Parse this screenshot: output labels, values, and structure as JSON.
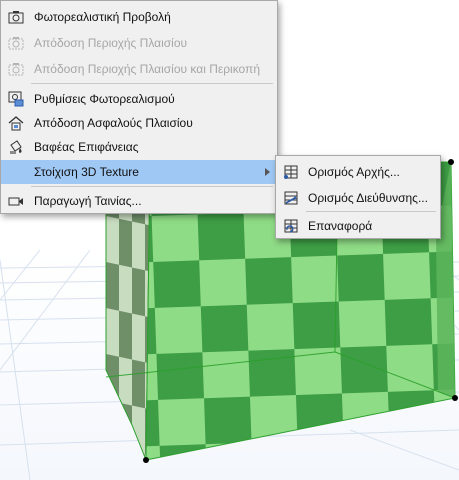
{
  "menu": {
    "items": [
      {
        "label": "Φωτορεαλιστική Προβολή",
        "icon": "camera-icon",
        "enabled": true
      },
      {
        "label": "Απόδοση Περιοχής Πλαισίου",
        "icon": "camera-marquee-icon",
        "enabled": false
      },
      {
        "label": "Απόδοση Περιοχής Πλαισίου και Περικοπή",
        "icon": "camera-crop-icon",
        "enabled": false
      },
      {
        "label": "Ρυθμίσεις Φωτορεαλισμού",
        "icon": "render-settings-icon",
        "enabled": true
      },
      {
        "label": "Απόδοση Ασφαλούς Πλαισίου",
        "icon": "safe-frame-icon",
        "enabled": true
      },
      {
        "label": "Βαφέας Επιφάνειας",
        "icon": "paint-bucket-icon",
        "enabled": true
      },
      {
        "label": "Στοίχιση 3D Texture",
        "icon": "",
        "enabled": true,
        "highlighted": true
      },
      {
        "label": "Παραγωγή Ταινίας...",
        "icon": "movie-camera-icon",
        "enabled": true
      }
    ]
  },
  "submenu": {
    "items": [
      {
        "label": "Ορισμός Αρχής...",
        "icon": "set-origin-icon"
      },
      {
        "label": "Ορισμός Διεύθυνσης...",
        "icon": "set-direction-icon"
      },
      {
        "label": "Επαναφορά",
        "icon": "reset-icon"
      }
    ]
  },
  "colors": {
    "menu_highlight": "#9fc8f4",
    "texture_light": "#8fdc86",
    "texture_dark": "#3e9e45",
    "edge": "#2ea02e"
  }
}
